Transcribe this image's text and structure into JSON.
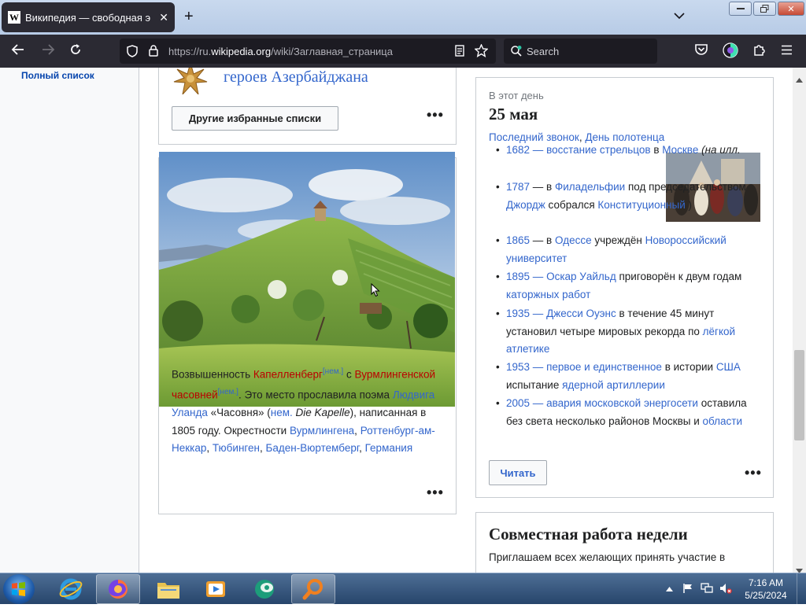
{
  "browser": {
    "tab_title": "Википедия — свободная энциклопедия",
    "tab_icon": "W",
    "url_prefix": "https://ru.",
    "url_host": "wikipedia.org",
    "url_path": "/wiki/Заглавная_страница",
    "search_placeholder": "Search"
  },
  "sidebar": {
    "link": "Полный список"
  },
  "featured_lists": {
    "heading_tail": "героев Азербайджана",
    "button": "Другие избранные списки"
  },
  "image_card": {
    "caption": {
      "p1": "Возвышенность ",
      "link1": "Капелленберг",
      "sup1": "[нем.]",
      "p2": " с ",
      "link2": "Вурмлингенской часовней",
      "sup2": "[нем.]",
      "p3": ". Это место прославила поэма ",
      "link3": "Людвига Уланда",
      "p4": " «Часовня» (",
      "link4": "нем.",
      "p5": " ",
      "italic": "Die Kapelle",
      "p6": "), написанная в 1805 году. Окрестности ",
      "link5": "Вурмлингена",
      "p7": ", ",
      "link6": "Роттенбург-ам-Неккар",
      "p8": ", ",
      "link7": "Тюбинген",
      "p9": ", ",
      "link8": "Баден-Вюртемберг",
      "p10": ", ",
      "link9": "Германия"
    }
  },
  "on_this_day": {
    "label": "В этот день",
    "date": "25 мая",
    "sub_a": "Последний звонок",
    "sub_sep": ", ",
    "sub_b": "День полотенца",
    "events": [
      {
        "y": "1682",
        "dash": " — ",
        "a": "восстание стрельцов",
        "t1": " в ",
        "b": "Москве",
        "t2": " ",
        "i": "(на илл.",
        "t3": ""
      },
      {
        "y": "1787",
        "dash": " — в ",
        "a": "Филадельфии",
        "t1": " под председательством ",
        "b": "Джордж",
        "t2": " собрался ",
        "i": "",
        "t3": "",
        "c": "Конституционный",
        "t4": " )"
      },
      {
        "y": "1865",
        "dash": " — в ",
        "a": "Одессе",
        "t1": " учреждён ",
        "b": "Новороссийский университет",
        "t2": "",
        "i": "",
        "t3": ""
      },
      {
        "y": "1895",
        "dash": " — ",
        "a": "Оскар Уайльд",
        "t1": " приговорён к двум годам ",
        "b": "каторжных работ",
        "t2": "",
        "i": "",
        "t3": ""
      },
      {
        "y": "1935",
        "dash": " — ",
        "a": "Джесси Оуэнс",
        "t1": " в течение 45 минут установил четыре мировых рекорда по ",
        "b": "лёгкой атлетике",
        "t2": "",
        "i": "",
        "t3": ""
      },
      {
        "y": "1953",
        "dash": " — ",
        "a": "первое и единственное",
        "t1": " в истории ",
        "b": "США",
        "t2": " испытание ",
        "i": "",
        "t3": "",
        "c": "ядерной артиллерии",
        "t4": ""
      },
      {
        "y": "2005",
        "dash": " — ",
        "a": "авария московской энергосети",
        "t1": " оставила без света несколько районов Москвы и ",
        "b": "области",
        "t2": "",
        "i": "",
        "t3": ""
      }
    ],
    "button": "Читать"
  },
  "collab": {
    "title": "Совместная работа недели",
    "text": "Приглашаем всех желающих принять участие в"
  },
  "taskbar": {
    "time": "7:16 AM",
    "date": "5/25/2024"
  }
}
